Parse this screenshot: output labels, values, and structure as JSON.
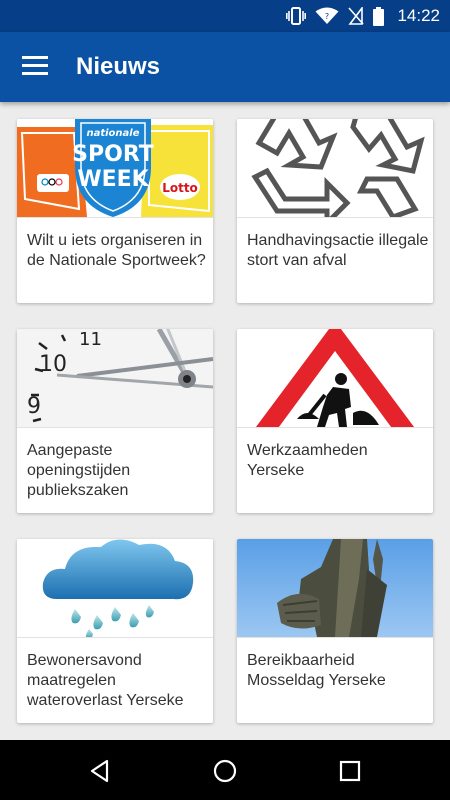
{
  "status_bar": {
    "time": "14:22",
    "icons": [
      "vibrate-icon",
      "wifi-icon",
      "no-sim-icon",
      "battery-icon"
    ]
  },
  "app_bar": {
    "title": "Nieuws",
    "menu_icon": "hamburger-menu-icon"
  },
  "news": [
    {
      "title": "Wilt u iets organiseren in de Nationale Sportweek?",
      "image": "nationale-sportweek-logo",
      "image_text": [
        "nationale",
        "SPORT",
        "WEEK",
        "Lotto"
      ]
    },
    {
      "title": "Handhavingsactie illegale stort van afval",
      "image": "recycle-symbol"
    },
    {
      "title": "Aangepaste openingstijden publiekszaken",
      "image": "clock-face",
      "image_text": [
        "11",
        "10",
        "9"
      ]
    },
    {
      "title": "Werkzaamheden Yerseke",
      "image": "road-works-sign"
    },
    {
      "title": "Bewonersavond maatregelen wateroverlast Yerseke",
      "image": "rain-cloud"
    },
    {
      "title": "Bereikbaarheid Mosseldag Yerseke",
      "image": "fisherman-statue"
    }
  ],
  "nav_bar": {
    "back": "back-icon",
    "home": "home-icon",
    "recents": "recents-icon"
  },
  "colors": {
    "status_bar": "#063f87",
    "app_bar": "#0b52a5",
    "background": "#ececec",
    "card": "#ffffff",
    "caption_text": "#333333"
  }
}
